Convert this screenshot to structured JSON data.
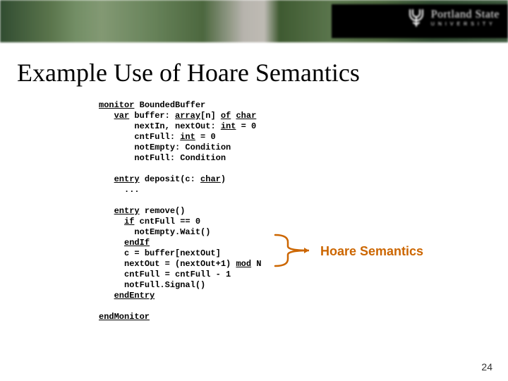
{
  "brand": {
    "line1": "Portland State",
    "line2": "UNIVERSITY"
  },
  "title": "Example Use of Hoare Semantics",
  "code": {
    "kw_monitor": "monitor",
    "bounded": " BoundedBuffer",
    "kw_var": "var",
    "buffer_decl_a": " buffer: ",
    "kw_array": "array",
    "buffer_decl_b": "[n] ",
    "kw_of": "of",
    "sp": " ",
    "kw_char": "char",
    "nextinout_a": "nextIn, nextOut: ",
    "kw_int": "int",
    "nextinout_b": " = 0",
    "cntfull_a": "cntFull: ",
    "cntfull_b": " = 0",
    "notempty": "notEmpty: Condition",
    "notfull": "notFull: Condition",
    "kw_entry": "entry",
    "deposit_a": " deposit(c: ",
    "deposit_b": ")",
    "ellipsis": "...",
    "remove": " remove()",
    "kw_if": "if",
    "if_cond": " cntFull == 0",
    "wait": "notEmpty.Wait()",
    "kw_endif": "endIf",
    "assign_c": "c = buffer[nextOut]",
    "nextout_a": "nextOut = (nextOut+1) ",
    "kw_mod": "mod",
    "nextout_b": " N",
    "cnt_assign": "cntFull = cntFull - 1",
    "signal": "notFull.Signal()",
    "kw_endentry": "endEntry",
    "kw_endmonitor": "endMonitor"
  },
  "callout": "Hoare Semantics",
  "page": "24"
}
